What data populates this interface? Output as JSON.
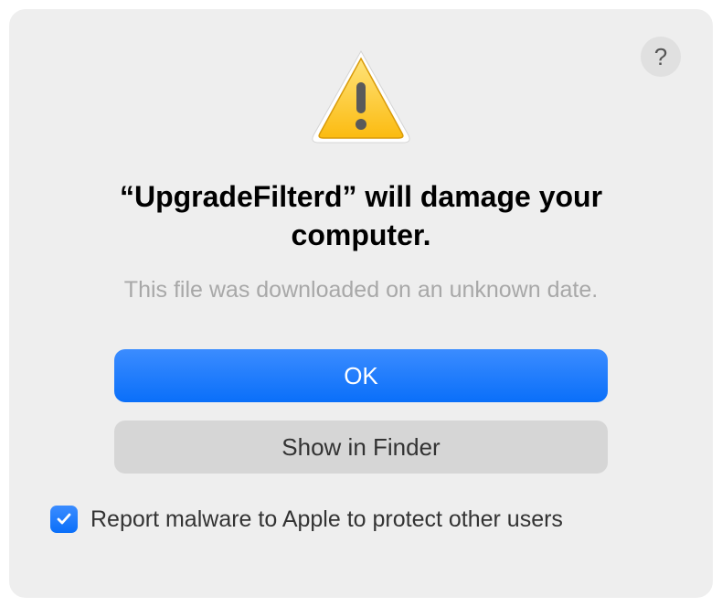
{
  "dialog": {
    "title": "“UpgradeFilterd” will damage your computer.",
    "subtitle": "This file was downloaded on an unknown date.",
    "primary_button": "OK",
    "secondary_button": "Show in Finder",
    "checkbox_label": "Report malware to Apple to protect other users",
    "checkbox_checked": true,
    "help_label": "?"
  },
  "colors": {
    "accent": "#0a6ff9",
    "warning_fill": "#fcc321",
    "warning_stroke": "#e6a817"
  }
}
